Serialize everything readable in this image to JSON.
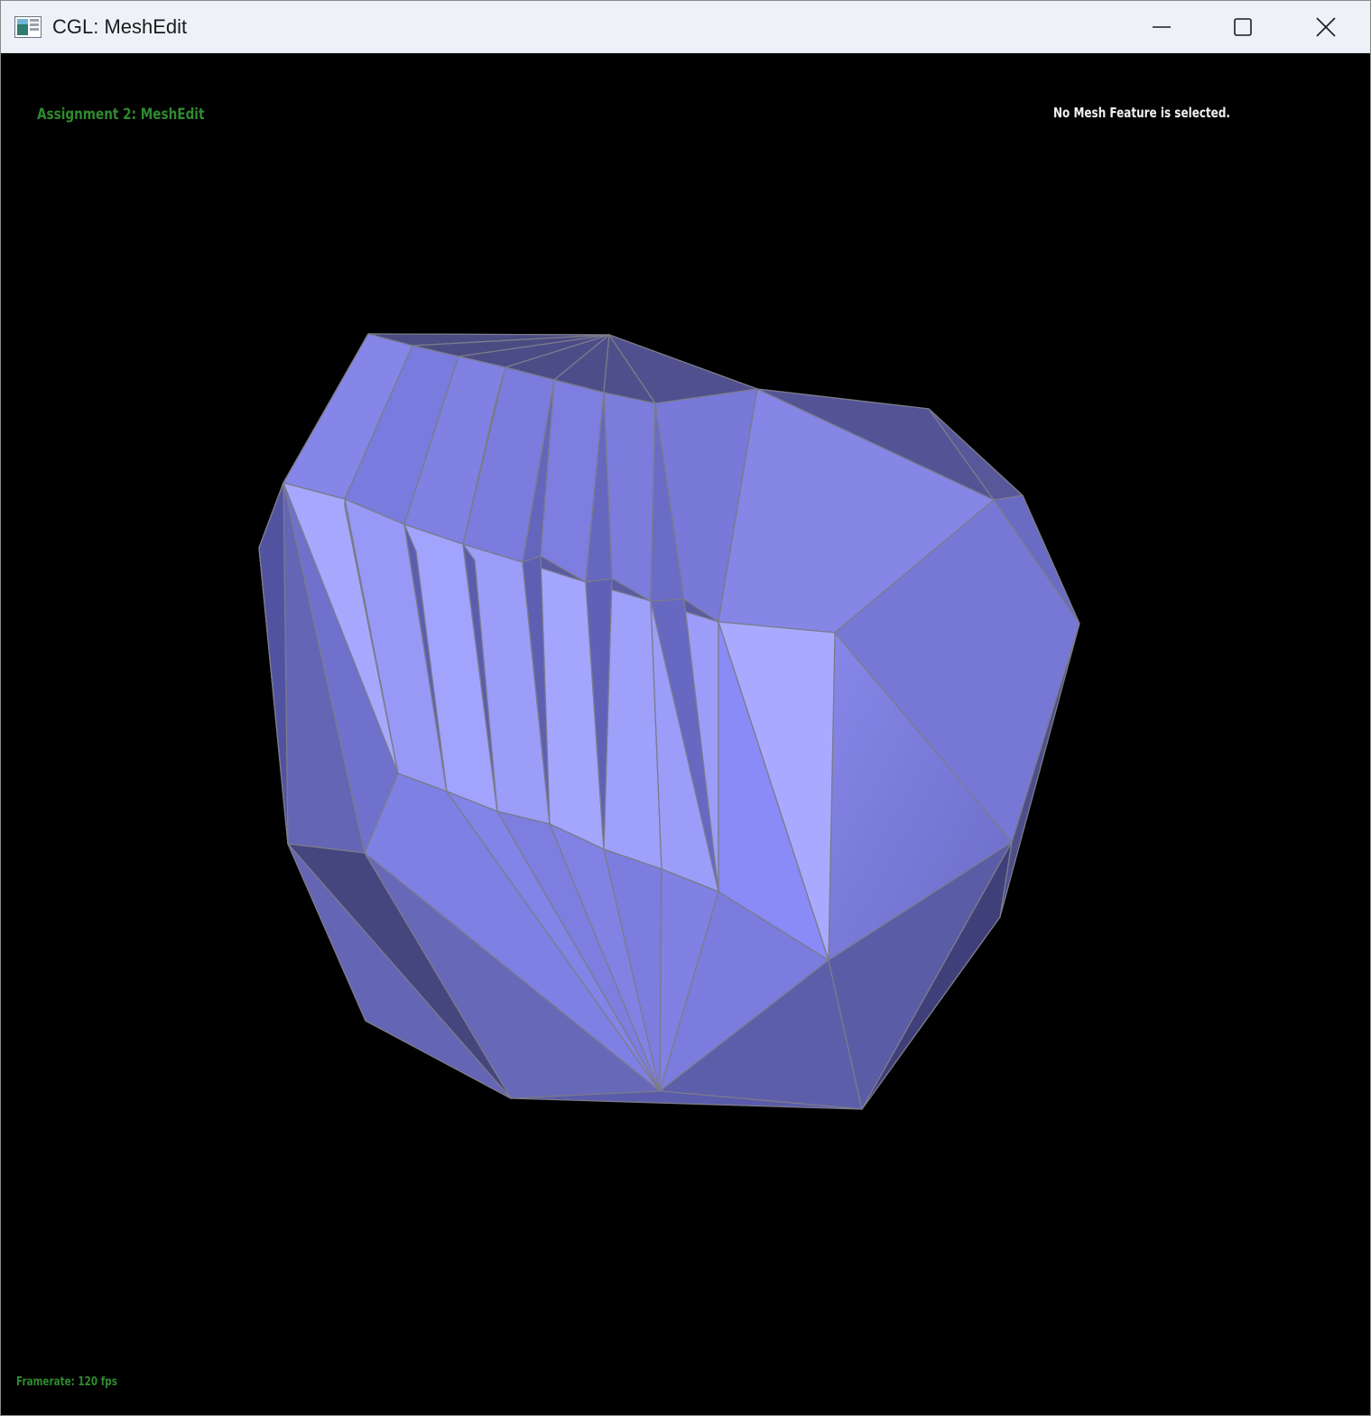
{
  "window": {
    "title": "CGL: MeshEdit",
    "app_icon": "app-window-icon",
    "controls": {
      "minimize_icon": "minimize-icon",
      "maximize_icon": "maximize-icon",
      "close_icon": "close-icon"
    }
  },
  "hud": {
    "title": "Assignment 2: MeshEdit",
    "status": "No Mesh Feature is selected.",
    "framerate": "Framerate: 120 fps"
  },
  "colors": {
    "background": "#000000",
    "mesh_face_light": "#a9aaff",
    "mesh_face_mid": "#8384e6",
    "mesh_face_dark": "#4a4b80",
    "mesh_edge": "#7b7b8c",
    "hud_green": "#2f8a2f",
    "hud_white": "#f2f2f2"
  }
}
